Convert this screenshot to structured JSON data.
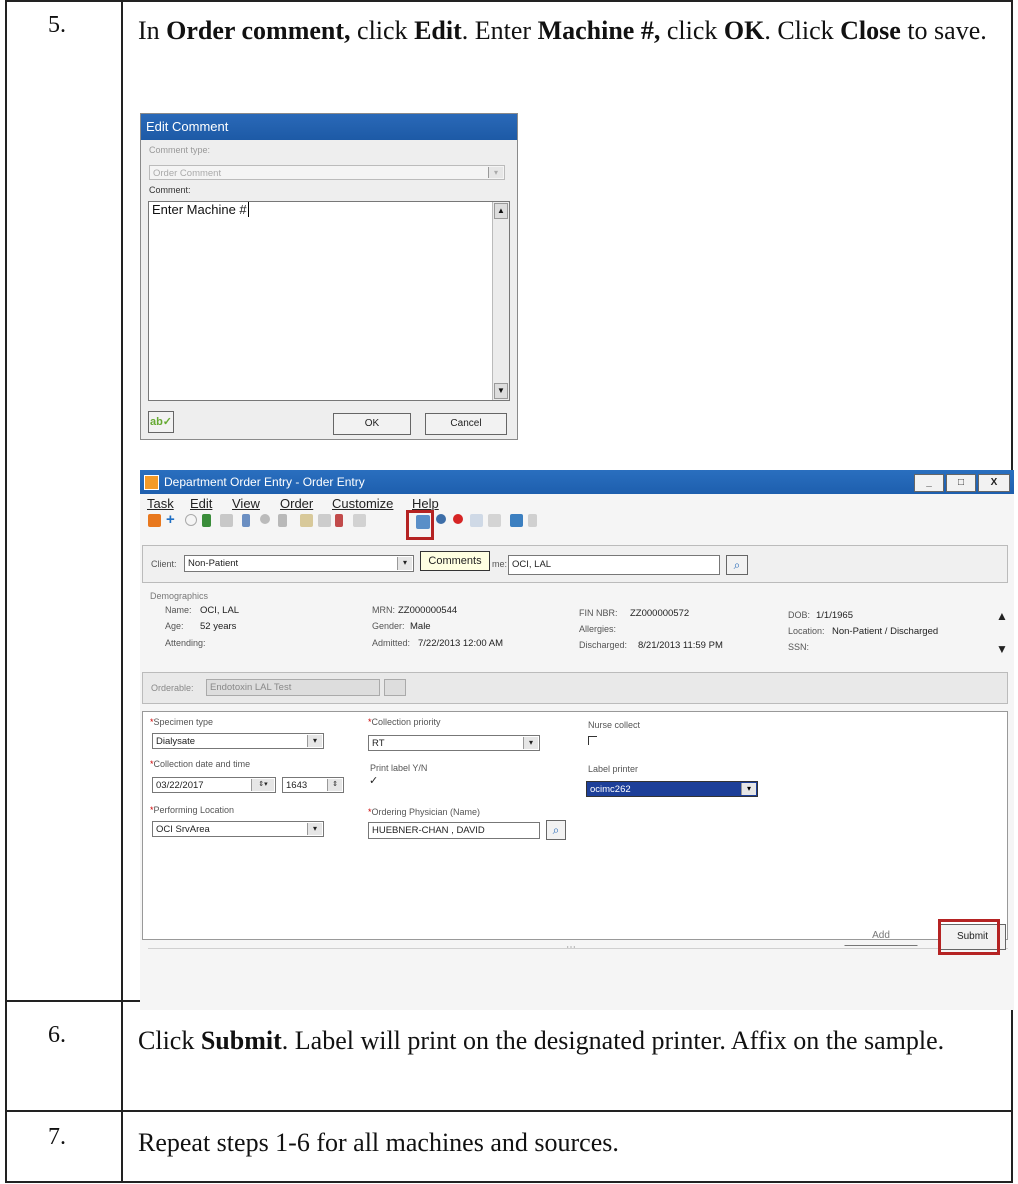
{
  "steps": [
    {
      "number": "5.",
      "text_html_parts": [
        "In ",
        "Order comment,",
        " click ",
        "Edit",
        ". Enter ",
        "Machine #,",
        " click ",
        "OK",
        ". Click ",
        "Close",
        " to save."
      ]
    },
    {
      "number": "6.",
      "text_html_parts": [
        "Click ",
        "Submit",
        ". Label will print on the designated printer. Affix on the sample."
      ]
    },
    {
      "number": "7.",
      "text_html_parts": [
        "Repeat steps 1-6 for all machines and sources."
      ]
    }
  ],
  "edit_comment": {
    "title": "Edit Comment",
    "comment_type_label": "Comment type:",
    "comment_type_value": "Order Comment",
    "comment_label": "Comment:",
    "comment_text": "Enter Machine #",
    "ok": "OK",
    "cancel": "Cancel"
  },
  "order_entry": {
    "title": "Department Order Entry - Order Entry",
    "window_buttons": [
      "_",
      "□",
      "X"
    ],
    "menu": [
      "Task",
      "Edit",
      "View",
      "Order",
      "Customize",
      "Help"
    ],
    "comments_tooltip": "Comments",
    "client_label": "Client:",
    "client_value": "Non-Patient",
    "name_label": "me:",
    "name_value": "OCI, LAL",
    "demographics": {
      "heading": "Demographics",
      "name_label": "Name:",
      "name_value": "OCI, LAL",
      "age_label": "Age:",
      "age_value": "52 years",
      "attending_label": "Attending:",
      "mrn_label": "MRN:",
      "mrn_value": "ZZ000000544",
      "gender_label": "Gender:",
      "gender_value": "Male",
      "admitted_label": "Admitted:",
      "admitted_value": "7/22/2013 12:00 AM",
      "fin_label": "FIN NBR:",
      "fin_value": "ZZ000000572",
      "allergies_label": "Allergies:",
      "discharged_label": "Discharged:",
      "discharged_value": "8/21/2013 11:59 PM",
      "dob_label": "DOB:",
      "dob_value": "1/1/1965",
      "location_label": "Location:",
      "location_value": "Non-Patient / Discharged",
      "ssn_label": "SSN:"
    },
    "orderable_label": "Orderable:",
    "orderable_value": "Endotoxin LAL Test",
    "form": {
      "specimen_type_label": "Specimen type",
      "specimen_type_value": "Dialysate",
      "collection_priority_label": "Collection priority",
      "collection_priority_value": "RT",
      "nurse_collect_label": "Nurse collect",
      "collection_dt_label": "Collection date and time",
      "collection_date": "03/22/2017",
      "collection_time": "1643",
      "print_label_label": "Print label Y/N",
      "label_printer_label": "Label printer",
      "label_printer_value": "ocimc262",
      "performing_location_label": "Performing Location",
      "performing_location_value": "OCI SrvArea",
      "ordering_physician_label": "Ordering Physician (Name)",
      "ordering_physician_value": "HUEBNER-CHAN , DAVID"
    },
    "add_button": "Add",
    "submit_button": "Submit"
  }
}
